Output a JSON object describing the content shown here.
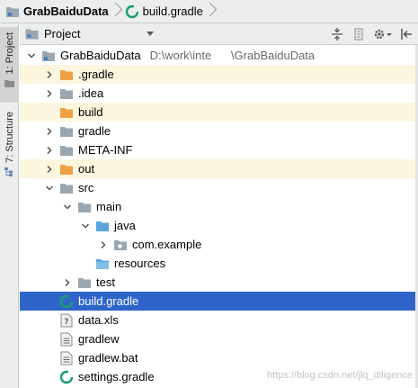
{
  "breadcrumb": {
    "project": "GrabBaiduData",
    "file": "build.gradle"
  },
  "side_tabs": {
    "project": "1: Project",
    "structure": "7: Structure"
  },
  "panel": {
    "view_mode": "Project"
  },
  "tree": [
    {
      "label": "GrabBaiduData",
      "path": "D:\\work\\inte      \\GrabBaiduData",
      "icon": "module-folder-icon",
      "depth": 0,
      "arrow": "down",
      "excluded": false,
      "selected": false
    },
    {
      "label": ".gradle",
      "icon": "excluded-folder-icon",
      "depth": 1,
      "arrow": "right",
      "excluded": true,
      "selected": false
    },
    {
      "label": ".idea",
      "icon": "folder-icon",
      "depth": 1,
      "arrow": "right",
      "excluded": false,
      "selected": false
    },
    {
      "label": "build",
      "icon": "excluded-folder-icon",
      "depth": 1,
      "arrow": "none",
      "excluded": true,
      "selected": false
    },
    {
      "label": "gradle",
      "icon": "folder-icon",
      "depth": 1,
      "arrow": "right",
      "excluded": false,
      "selected": false
    },
    {
      "label": "META-INF",
      "icon": "folder-icon",
      "depth": 1,
      "arrow": "right",
      "excluded": false,
      "selected": false
    },
    {
      "label": "out",
      "icon": "excluded-folder-icon",
      "depth": 1,
      "arrow": "right",
      "excluded": true,
      "selected": false
    },
    {
      "label": "src",
      "icon": "folder-icon",
      "depth": 1,
      "arrow": "down",
      "excluded": false,
      "selected": false
    },
    {
      "label": "main",
      "icon": "folder-icon",
      "depth": 2,
      "arrow": "down",
      "excluded": false,
      "selected": false
    },
    {
      "label": "java",
      "icon": "source-folder-icon",
      "depth": 3,
      "arrow": "down",
      "excluded": false,
      "selected": false
    },
    {
      "label": "com.example",
      "icon": "package-icon",
      "depth": 4,
      "arrow": "right",
      "excluded": false,
      "selected": false
    },
    {
      "label": "resources",
      "icon": "resources-folder-icon",
      "depth": 3,
      "arrow": "none",
      "excluded": false,
      "selected": false
    },
    {
      "label": "test",
      "icon": "folder-icon",
      "depth": 2,
      "arrow": "right",
      "excluded": false,
      "selected": false
    },
    {
      "label": "build.gradle",
      "icon": "gradle-file-icon",
      "depth": 1,
      "arrow": "none",
      "excluded": false,
      "selected": true
    },
    {
      "label": "data.xls",
      "icon": "unknown-file-icon",
      "depth": 1,
      "arrow": "none",
      "excluded": false,
      "selected": false
    },
    {
      "label": "gradlew",
      "icon": "text-file-icon",
      "depth": 1,
      "arrow": "none",
      "excluded": false,
      "selected": false
    },
    {
      "label": "gradlew.bat",
      "icon": "text-file-icon",
      "depth": 1,
      "arrow": "none",
      "excluded": false,
      "selected": false
    },
    {
      "label": "settings.gradle",
      "icon": "gradle-file-icon",
      "depth": 1,
      "arrow": "none",
      "excluded": false,
      "selected": false
    }
  ],
  "watermark": "https://blog.csdn.net/jlq_diligence",
  "colors": {
    "selection": "#2f65ca",
    "excluded_row": "#fcf6de",
    "excluded_folder": "#f0a044",
    "folder": "#9aa7b0",
    "source_folder": "#5aa4de",
    "gradle": "#1a9e6e"
  }
}
